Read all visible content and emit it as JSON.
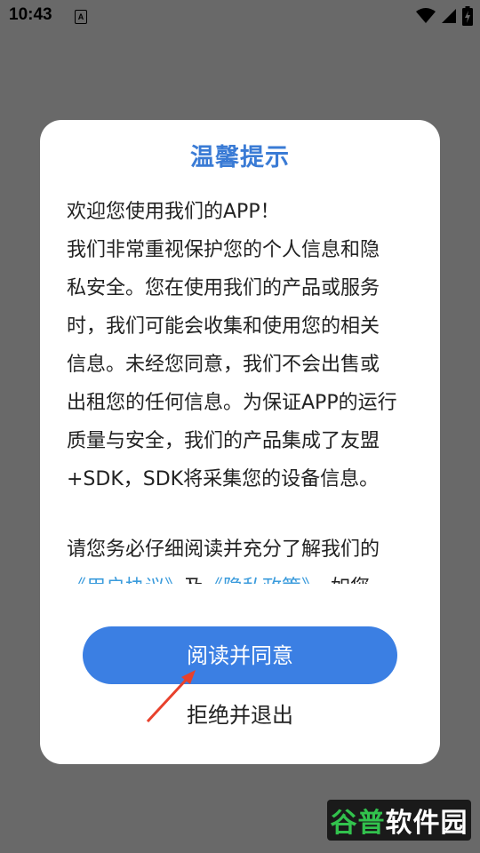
{
  "status_bar": {
    "time": "10:43",
    "notification_icon_letter": "A",
    "icons": [
      "wifi-icon",
      "signal-icon",
      "battery-charging-icon"
    ]
  },
  "dialog": {
    "title": "温馨提示",
    "lines": [
      "欢迎您使用我们的APP！",
      "我们非常重视保护您的个人信息和隐",
      "私安全。您在使用我们的产品或服务",
      "时，我们可能会收集和使用您的相关",
      "信息。未经您同意，我们不会出售或",
      "出租您的任何信息。为保证APP的运行",
      "质量与安全，我们的产品集成了友盟",
      "+SDK，SDK将采集您的设备信息。"
    ],
    "para2_line1": "请您务必仔细阅读并充分了解我们的",
    "user_agreement_link": "《用户协议》",
    "and_text": "及",
    "privacy_policy_link": "《隐私政策》",
    "tail_text": "，如您",
    "accept_button": "阅读并同意",
    "reject_button": "拒绝并退出"
  },
  "watermark": {
    "part1": "谷普",
    "part2": "软件园"
  },
  "colors": {
    "title": "#3a7bd5",
    "primary_button": "#3b7fe3",
    "link": "#3a9bdc",
    "overlay": "#696969",
    "arrow": "#e8412c"
  }
}
